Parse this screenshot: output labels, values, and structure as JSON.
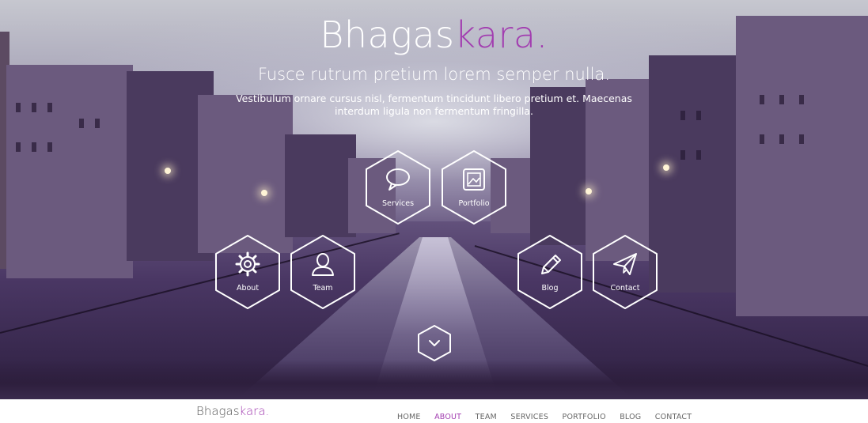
{
  "hero": {
    "logo_main": "Bhagas",
    "logo_accent": "kara",
    "logo_dot": ".",
    "tagline": "Fusce rutrum pretium lorem semper nulla.",
    "subtext": "Vestibulum ornare cursus nisl, fermentum tincidunt libero pretium et. Maecenas interdum ligula non fermentum fringilla."
  },
  "hex_buttons": [
    {
      "label": "Services",
      "icon": "speech-bubble-icon"
    },
    {
      "label": "Portfolio",
      "icon": "picture-frame-icon"
    },
    {
      "label": "About",
      "icon": "gear-icon"
    },
    {
      "label": "Team",
      "icon": "person-icon"
    },
    {
      "label": "Blog",
      "icon": "pencil-icon"
    },
    {
      "label": "Contact",
      "icon": "paper-plane-icon"
    }
  ],
  "scroll_down": {
    "icon": "chevron-down-icon"
  },
  "navbar": {
    "logo_main": "Bhagas",
    "logo_accent": "kara",
    "logo_dot": ".",
    "items": [
      "HOME",
      "ABOUT",
      "TEAM",
      "SERVICES",
      "PORTFOLIO",
      "BLOG",
      "CONTACT"
    ],
    "active": "ABOUT"
  },
  "colors": {
    "accent": "#a23db0",
    "hero_overlay": "#4a3764",
    "nav_text": "#666666"
  }
}
